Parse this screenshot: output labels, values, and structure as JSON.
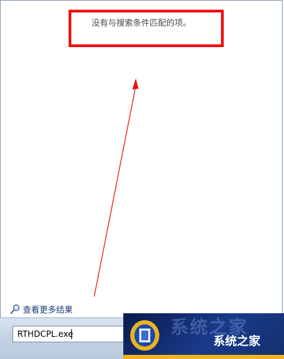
{
  "results": {
    "no_match_message": "没有与搜索条件匹配的项。"
  },
  "links": {
    "see_more_label": "查看更多结果",
    "see_more_icon": "search-icon"
  },
  "search": {
    "value": "RTHDCPL.exe"
  },
  "annotation": {
    "highlight_color": "#ee1111",
    "arrow_color": "#ee1111"
  },
  "watermark": {
    "text": "系统之家"
  }
}
